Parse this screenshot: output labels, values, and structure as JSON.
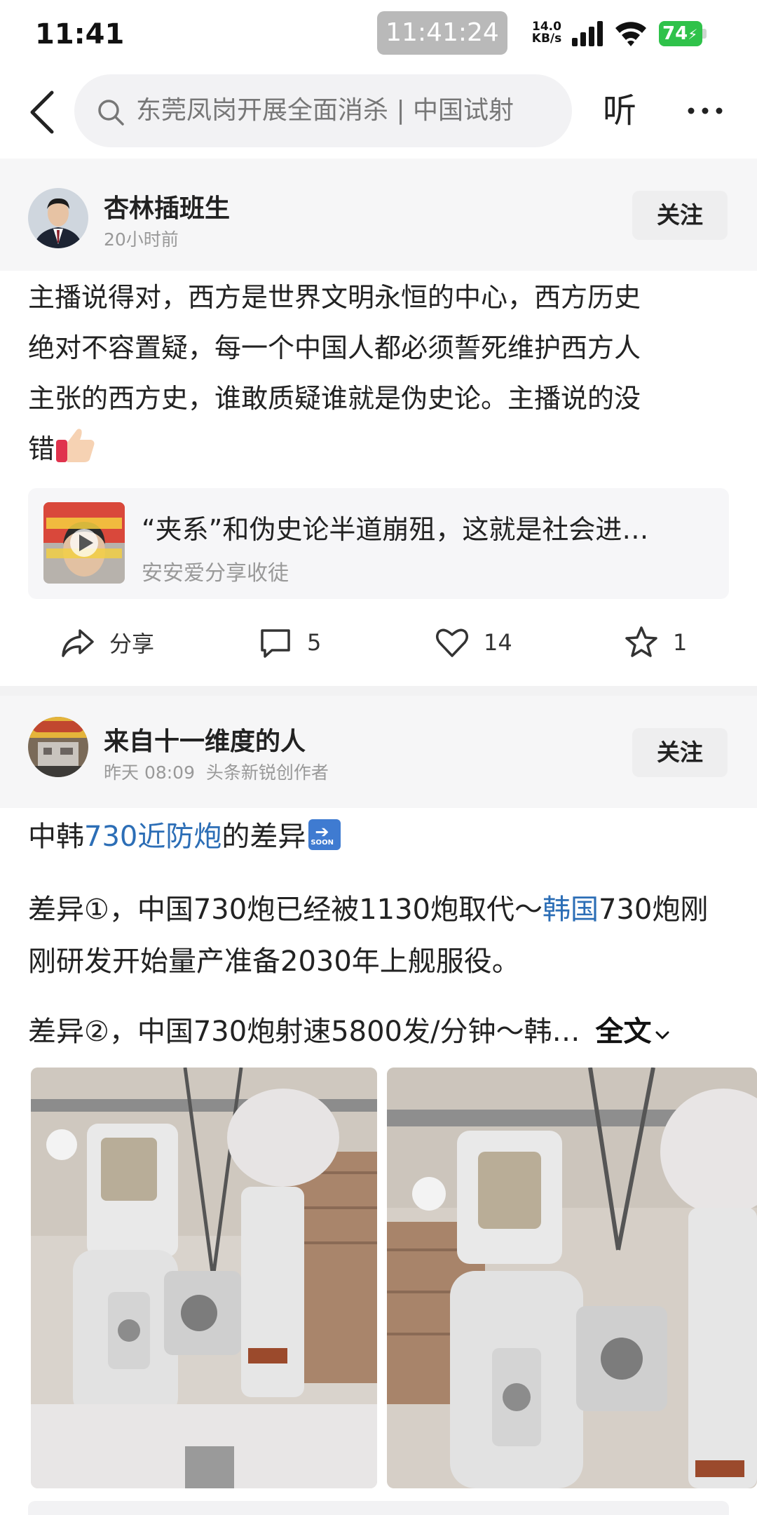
{
  "status_bar": {
    "time": "11:41",
    "clock_pill": "11:41:24",
    "net_speed_value": "14.0",
    "net_speed_unit": "KB/s",
    "battery": "74"
  },
  "nav": {
    "search_query": "东莞凤岗开展全面消杀 | 中国试射",
    "listen_label": "听"
  },
  "posts": [
    {
      "author": "杏林插班生",
      "meta_time": "20小时前",
      "follow_label": "关注",
      "text_lines": [
        "主播说得对，西方是世界文明永恒的中心，西方历史",
        "绝对不容置疑，每一个中国人都必须誓死维护西方人",
        "主张的西方史，谁敢质疑谁就是伪史论。主播说的没",
        "错"
      ],
      "quote": {
        "title": "“夹系”和伪史论半道崩殂，这就是社会进…",
        "source": "安安爱分享收徒"
      },
      "actions": {
        "share": "分享",
        "comments": "5",
        "likes": "14",
        "favorites": "1"
      }
    },
    {
      "author": "来自十一维度的人",
      "meta_time": "昨天  08:09",
      "meta_badge": "头条新锐创作者",
      "follow_label": "关注",
      "title_prefix": "中韩",
      "title_link": "730近防炮",
      "title_suffix": "的差异",
      "para1_a": "差异①，中国730炮已经被1130炮取代～",
      "para1_link": "韩国",
      "para1_b": "730炮刚",
      "para1_line2": "刚研发开始量产准备2030年上舰服役。",
      "para2": "差异②，中国730炮射速5800发/分钟～韩…",
      "full_text_label": "全文",
      "emoji_soon": "SOON"
    }
  ],
  "colors": {
    "link": "#2c6eb6",
    "battery": "#2fc24a",
    "head_bg": "#f6f6f7"
  }
}
